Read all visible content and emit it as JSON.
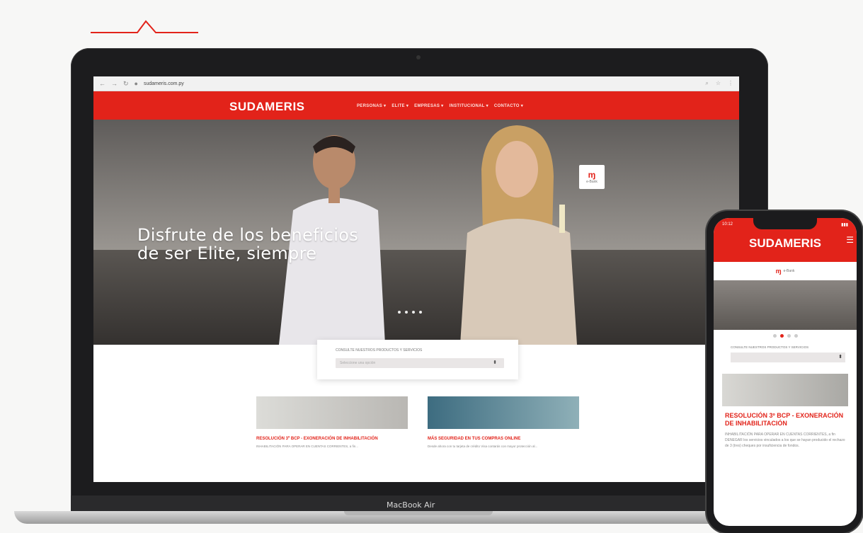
{
  "browser": {
    "url": "sudameris.com.py"
  },
  "site": {
    "logo": "SUDAMERIS",
    "menu": [
      "PERSONAS ▾",
      "ELITE ▾",
      "EMPRESAS ▾",
      "INSTITUCIONAL ▾",
      "CONTACTO ▾"
    ],
    "badge_label": "e-Bank"
  },
  "hero": {
    "title_line1": "Disfrute de los beneficios",
    "title_line2": "de ser Elite, siempre"
  },
  "search": {
    "label": "CONSULTE NUESTROS PRODUCTOS Y SERVICIOS",
    "placeholder": "Seleccione una opción"
  },
  "news": [
    {
      "title": "RESOLUCIÓN 3º BCP - EXONERACIÓN DE INHABILITACIÓN",
      "text": "INHABILITACIÓN PARA OPERAR EN CUENTAS CORRIENTES, a fin..."
    },
    {
      "title": "MÁS SEGURIDAD EN TUS COMPRAS ONLINE",
      "text": "Desde ahora con tu tarjeta de crédito Visa contarás con mayor protección al..."
    }
  ],
  "laptop": {
    "model": "MacBook Air"
  },
  "phone": {
    "time": "10:12",
    "logo": "SUDAMERIS",
    "badge_label": "e-Bank",
    "search_label": "CONSULTE NUESTROS PRODUCTOS Y SERVICIOS",
    "news_title": "RESOLUCIÓN 3º BCP - EXONERACIÓN DE INHABILITACIÓN",
    "news_text": "INHABILITACIÓN PARA OPERAR EN CUENTAS CORRIENTES, a fin DENEGAR los servicios vinculados a los que se hayan producido el rechazo de 3 (tres) cheques por insuficiencia de fondos."
  },
  "colors": {
    "brand": "#e2231a"
  }
}
